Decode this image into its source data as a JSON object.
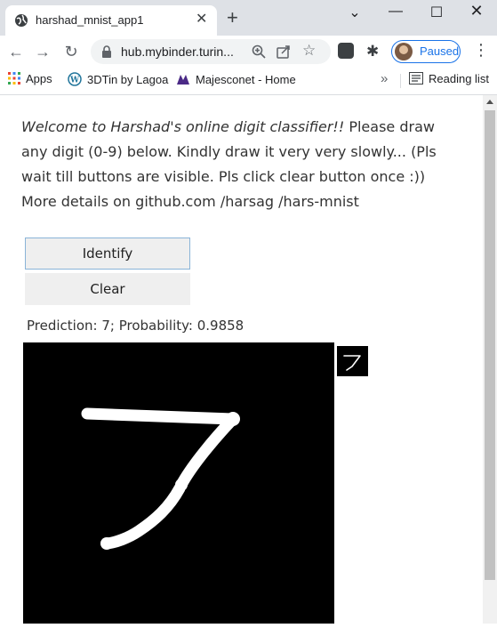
{
  "browser": {
    "tab_title": "harshad_mnist_app1",
    "tab_close": "✕",
    "new_tab": "+",
    "url": "hub.mybinder.turin...",
    "profile_label": "Paused",
    "window_controls": {
      "chevron": "⌄",
      "minimize": "—",
      "maximize": "☐",
      "close": "✕"
    }
  },
  "bookmarks": {
    "apps_label": "Apps",
    "items": [
      {
        "label": "3DTin by Lagoa",
        "icon": "wordpress-icon"
      },
      {
        "label": "Majesconet - Home",
        "icon": "majesco-icon"
      }
    ],
    "more_label": "»",
    "reading_list_label": "Reading list"
  },
  "page": {
    "intro_italic": "Welcome to Harshad's online digit classifier!!",
    "intro_rest": " Please draw any digit (0-9) below. Kindly draw it very very slowly... (Pls wait till buttons are visible. Pls click clear button once :)) More details on github.com /harsag /hars-mnist",
    "identify_label": "Identify",
    "clear_label": "Clear",
    "prediction_text": "Prediction: 7; Probability: 0.9858",
    "drawn_digit": "7"
  },
  "colors": {
    "chrome_bg": "#dee1e6",
    "accent": "#1a73e8",
    "canvas_bg": "#000000",
    "stroke": "#ffffff"
  }
}
